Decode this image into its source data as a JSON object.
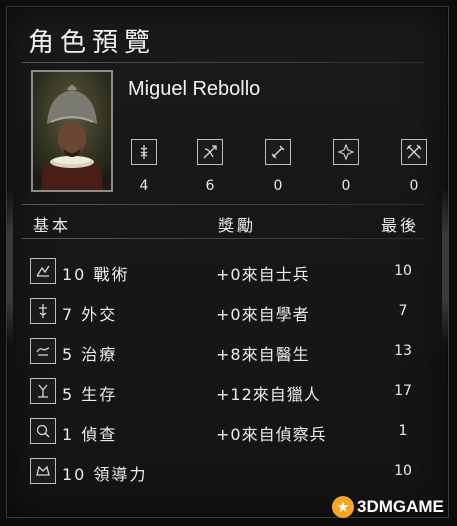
{
  "panel": {
    "title": "角色預覽"
  },
  "character": {
    "name": "Miguel Rebollo"
  },
  "stats": [
    {
      "icon": "caduceus-icon",
      "value": "4"
    },
    {
      "icon": "bow-arrow-icon",
      "value": "6"
    },
    {
      "icon": "sword-icon",
      "value": "0"
    },
    {
      "icon": "compass-star-icon",
      "value": "0"
    },
    {
      "icon": "crossed-swords-icon",
      "value": "0"
    }
  ],
  "table": {
    "headers": {
      "basic": "基本",
      "bonus": "獎勵",
      "final": "最後"
    },
    "rows": [
      {
        "icon": "tactics-icon",
        "label": "10 戰術",
        "bonus": "+0來自士兵",
        "final": "10"
      },
      {
        "icon": "diplomacy-icon",
        "label": "7 外交",
        "bonus": "+0來自學者",
        "final": "7"
      },
      {
        "icon": "healing-icon",
        "label": "5 治療",
        "bonus": "+8來自醫生",
        "final": "13"
      },
      {
        "icon": "survival-icon",
        "label": "5 生存",
        "bonus": "+12來自獵人",
        "final": "17"
      },
      {
        "icon": "scouting-icon",
        "label": "1 偵查",
        "bonus": "+0來自偵察兵",
        "final": "1"
      },
      {
        "icon": "leadership-icon",
        "label": "10 領導力",
        "bonus": "",
        "final": "10"
      }
    ]
  },
  "watermark": {
    "text": "3DMGAME"
  }
}
